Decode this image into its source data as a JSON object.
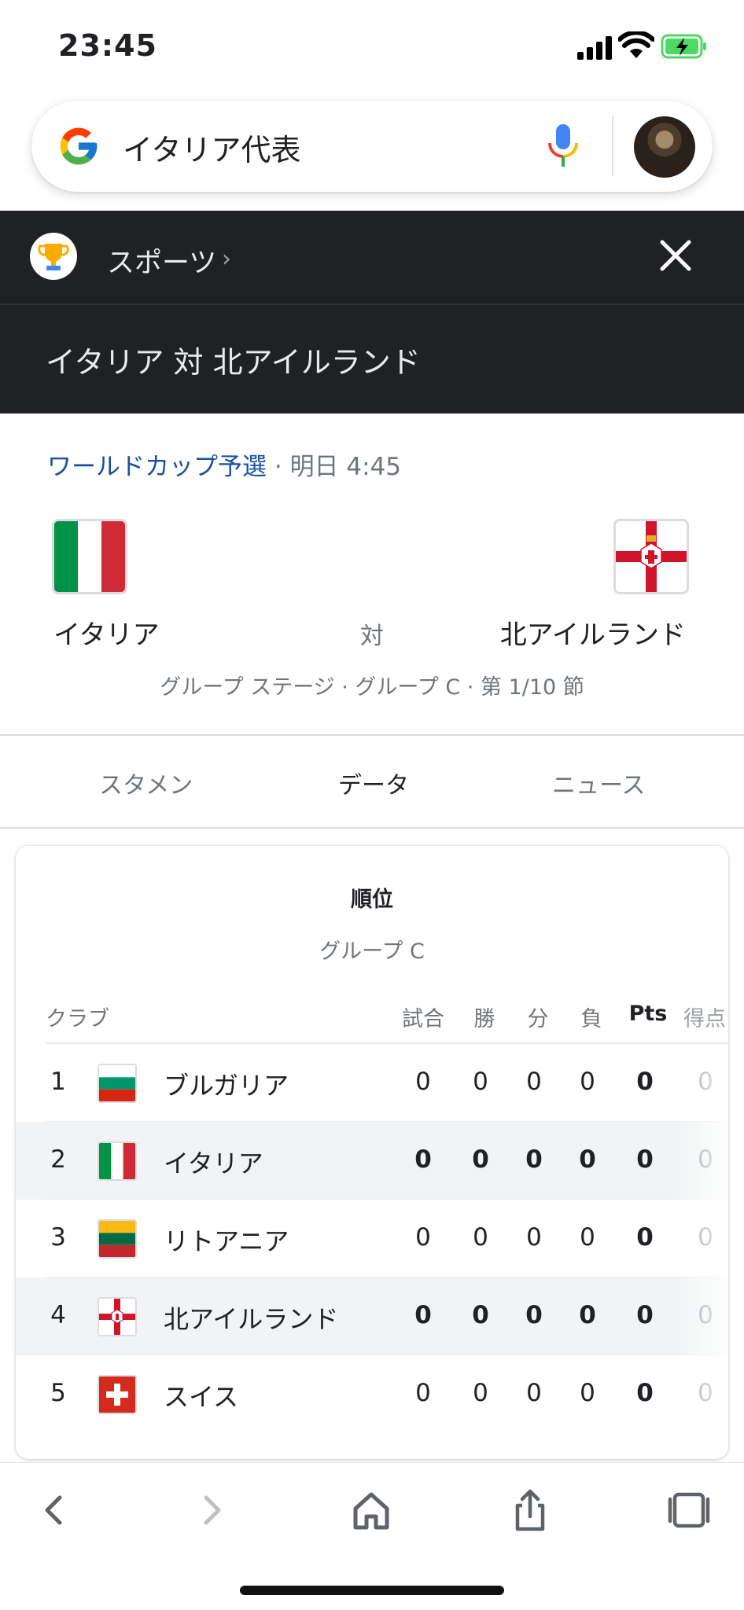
{
  "status_bar": {
    "time": "23:45"
  },
  "search": {
    "query": "イタリア代表"
  },
  "header": {
    "category": "スポーツ",
    "chevron": "›",
    "match_title": "イタリア 対 北アイルランド"
  },
  "match": {
    "competition": "ワールドカップ予選",
    "separator": " · ",
    "kickoff": "明日 4:45",
    "home_team": "イタリア",
    "away_team": "北アイルランド",
    "vs": "対",
    "stage": "グループ ステージ · グループ C · 第 1/10 節"
  },
  "tabs": [
    {
      "label": "スタメン"
    },
    {
      "label": "データ"
    },
    {
      "label": "ニュース"
    }
  ],
  "standings": {
    "title": "順位",
    "group": "グループ C",
    "columns": [
      "クラブ",
      "試合",
      "勝",
      "分",
      "負",
      "Pts",
      "得点"
    ],
    "rows": [
      {
        "rank": "1",
        "team": "ブルガリア",
        "played": "0",
        "won": "0",
        "drawn": "0",
        "lost": "0",
        "pts": "0",
        "goals": "0",
        "flag": "bulgaria-flag"
      },
      {
        "rank": "2",
        "team": "イタリア",
        "played": "0",
        "won": "0",
        "drawn": "0",
        "lost": "0",
        "pts": "0",
        "goals": "0",
        "flag": "italy-flag"
      },
      {
        "rank": "3",
        "team": "リトアニア",
        "played": "0",
        "won": "0",
        "drawn": "0",
        "lost": "0",
        "pts": "0",
        "goals": "0",
        "flag": "lithuania-flag"
      },
      {
        "rank": "4",
        "team": "北アイルランド",
        "played": "0",
        "won": "0",
        "drawn": "0",
        "lost": "0",
        "pts": "0",
        "goals": "0",
        "flag": "northern-ireland-flag"
      },
      {
        "rank": "5",
        "team": "スイス",
        "played": "0",
        "won": "0",
        "drawn": "0",
        "lost": "0",
        "pts": "0",
        "goals": "0",
        "flag": "switzerland-flag"
      }
    ]
  },
  "colors": {
    "header_background": "#202124",
    "link": "#1a4fa0",
    "italy_green": "#009246",
    "italy_red": "#ce2b37",
    "battery_green": "#4cd964"
  }
}
